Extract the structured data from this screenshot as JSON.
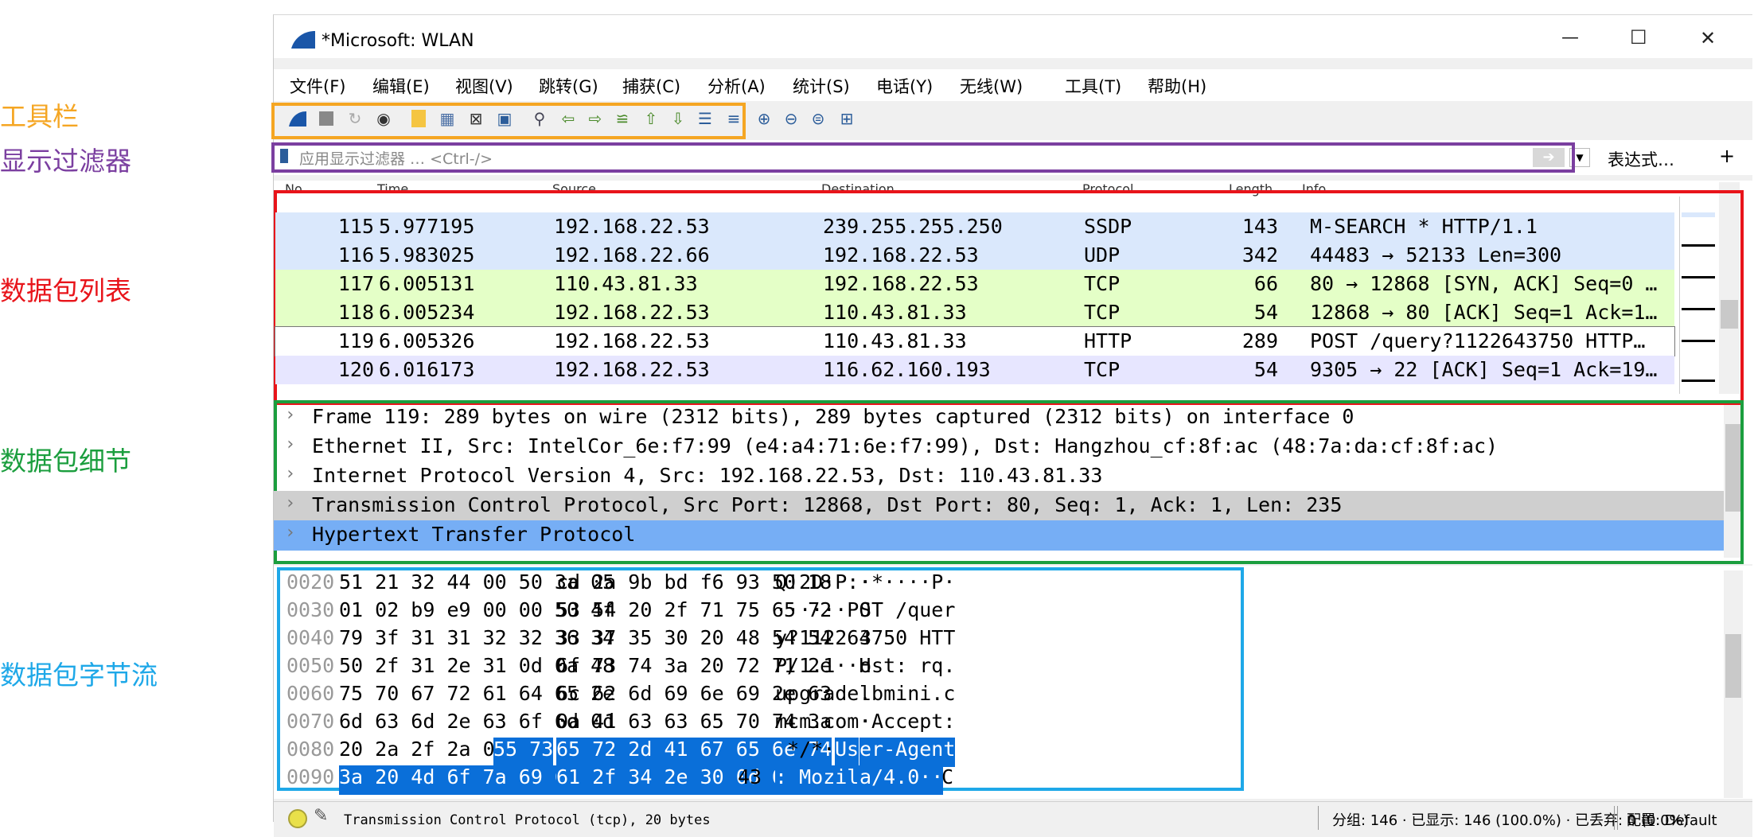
{
  "annotations": {
    "toolbar": "工具栏",
    "display_filter": "显示过滤器",
    "packet_list": "数据包列表",
    "packet_details": "数据包细节",
    "packet_bytes": "数据包字节流"
  },
  "window": {
    "title": "*Microsoft: WLAN",
    "minimize": "—",
    "maximize": "☐",
    "close": "✕"
  },
  "menu": [
    "文件(F)",
    "编辑(E)",
    "视图(V)",
    "跳转(G)",
    "捕获(C)",
    "分析(A)",
    "统计(S)",
    "电话(Y)",
    "无线(W)",
    "工具(T)",
    "帮助(H)"
  ],
  "filter": {
    "placeholder": "应用显示过滤器 … <Ctrl-/>",
    "expression_label": "表达式…",
    "plus": "+"
  },
  "packet_list": {
    "headers": {
      "no": "No.",
      "time": "Time",
      "source": "Source",
      "destination": "Destination",
      "protocol": "Protocol",
      "length": "Length",
      "info": "Info"
    },
    "rows": [
      {
        "no": "115",
        "time": "5.977195",
        "source": "192.168.22.53",
        "destination": "239.255.255.250",
        "protocol": "SSDP",
        "length": "143",
        "info": "M-SEARCH * HTTP/1.1"
      },
      {
        "no": "116",
        "time": "5.983025",
        "source": "192.168.22.66",
        "destination": "192.168.22.53",
        "protocol": "UDP",
        "length": "342",
        "info": "44483 → 52133 Len=300"
      },
      {
        "no": "117",
        "time": "6.005131",
        "source": "110.43.81.33",
        "destination": "192.168.22.53",
        "protocol": "TCP",
        "length": "66",
        "info": "80 → 12868 [SYN, ACK] Seq=0 …"
      },
      {
        "no": "118",
        "time": "6.005234",
        "source": "192.168.22.53",
        "destination": "110.43.81.33",
        "protocol": "TCP",
        "length": "54",
        "info": "12868 → 80 [ACK] Seq=1 Ack=1…"
      },
      {
        "no": "119",
        "time": "6.005326",
        "source": "192.168.22.53",
        "destination": "110.43.81.33",
        "protocol": "HTTP",
        "length": "289",
        "info": "POST /query?1122643750 HTTP…"
      },
      {
        "no": "120",
        "time": "6.016173",
        "source": "192.168.22.53",
        "destination": "116.62.160.193",
        "protocol": "TCP",
        "length": "54",
        "info": "9305 → 22 [ACK] Seq=1 Ack=19…"
      }
    ],
    "row_colors": [
      "#dae8fc",
      "#dae8fc",
      "#e4ffc7",
      "#e4ffc7",
      "#ffffff",
      "#e7e6ff"
    ]
  },
  "details": [
    "Frame 119: 289 bytes on wire (2312 bits), 289 bytes captured (2312 bits) on interface 0",
    "Ethernet II, Src: IntelCor_6e:f7:99 (e4:a4:71:6e:f7:99), Dst: Hangzhou_cf:8f:ac (48:7a:da:cf:8f:ac)",
    "Internet Protocol Version 4, Src: 192.168.22.53, Dst: 110.43.81.33",
    "Transmission Control Protocol, Src Port: 12868, Dst Port: 80, Seq: 1, Ack: 1, Len: 235",
    "Hypertext Transfer Protocol"
  ],
  "bytes": [
    {
      "offset": "0020",
      "hex1": "51 21 32 44 00 50 3a 05",
      "hex2": "cd 2a 9b bd f6 93 50 18",
      "ascii1": "Q!2D·P:·",
      "ascii2": "·*····P·"
    },
    {
      "offset": "0030",
      "hex1": "01 02 b9 e9 00 00 50 4f",
      "hex2": "53 54 20 2f 71 75 65 72",
      "ascii1": "······PO",
      "ascii2": "ST /quer"
    },
    {
      "offset": "0040",
      "hex1": "79 3f 31 31 32 32 36 34",
      "hex2": "33 37 35 30 20 48 54 54",
      "ascii1": "y?112264",
      "ascii2": "3750 HTT"
    },
    {
      "offset": "0050",
      "hex1": "50 2f 31 2e 31 0d 0a 48",
      "hex2": "6f 73 74 3a 20 72 71 2e",
      "ascii1": "P/1.1··H",
      "ascii2": "ost: rq."
    },
    {
      "offset": "0060",
      "hex1": "75 70 67 72 61 64 65 2e",
      "hex2": "6c 62 6d 69 6e 69 2e 63",
      "ascii1": "upgrade.",
      "ascii2": "lbmini.c"
    },
    {
      "offset": "0070",
      "hex1": "6d 63 6d 2e 63 6f 6d 0d",
      "hex2": "0a 41 63 63 65 70 74 3a",
      "ascii1": "mcm.com·",
      "ascii2": "·Accept:"
    },
    {
      "offset": "0080",
      "hex1a": "20 2a 2f 2a 0d 0a ",
      "hex1b": "55 73",
      "hex2": "65 72 2d 41 67 65 6e 74",
      "ascii1a": " */*··",
      "ascii1b": "Us",
      "ascii2": "er-Agent"
    },
    {
      "offset": "0090",
      "hex1": "3a 20 4d 6f 7a 69 6c 6c",
      "hex2a": "61 2f 34 2e 30 0d 0a",
      "hex2b": "43",
      "ascii1": ": Mozill",
      "ascii2a": "a/4.0··",
      "ascii2b": "C"
    }
  ],
  "status": {
    "field_info": "Transmission Control Protocol (tcp), 20 bytes",
    "counts": "分组: 146 · 已显示: 146 (100.0%) · 已丢弃: 0 (0.0%)",
    "profile": "配置: Default"
  },
  "colors": {
    "toolbar_box": "#f5a623",
    "filter_box": "#7b3fa0",
    "list_box": "#e8141a",
    "details_box": "#1b9e3e",
    "bytes_box": "#1ea8e8",
    "selection": "#0a6fd9"
  }
}
